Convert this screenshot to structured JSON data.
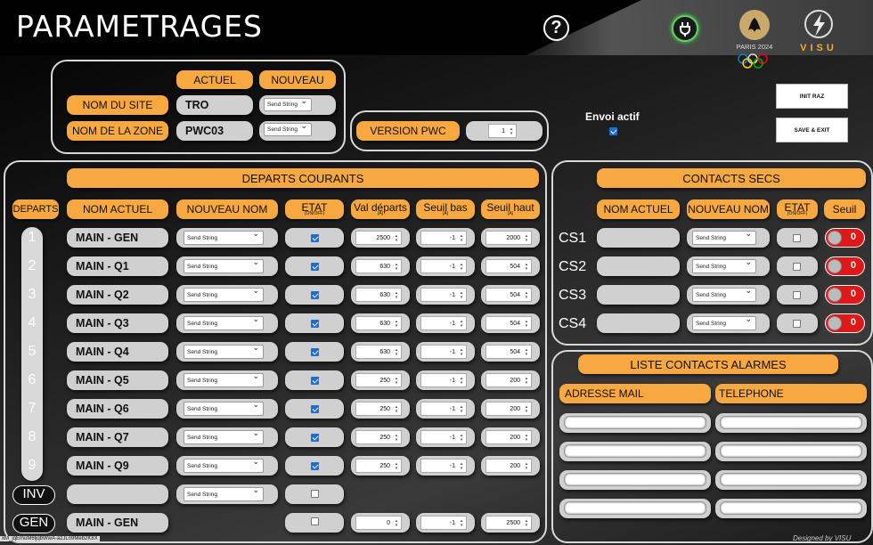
{
  "header": {
    "title": "PARAMETRAGES",
    "help": "?",
    "visu": "VISU",
    "paris": "PARIS 2024"
  },
  "site": {
    "col_actuel": "ACTUEL",
    "col_nouveau": "NOUVEAU",
    "rows": [
      {
        "label": "NOM DU SITE",
        "value": "TRO",
        "select": "Send String"
      },
      {
        "label": "NOM DE LA ZONE",
        "value": "PWC03",
        "select": "Send String"
      }
    ]
  },
  "version": {
    "label": "VERSION PWC",
    "value": "1"
  },
  "envoi": {
    "label": "Envoi actif",
    "checked": true
  },
  "buttons": {
    "init_raz": "INIT RAZ",
    "save_exit": "SAVE & EXIT"
  },
  "departs": {
    "title": "DEPARTS COURANTS",
    "headers": {
      "departs": "DEPARTS",
      "nom": "NOM ACTUEL",
      "nouveau": "NOUVEAU NOM",
      "etat": "ETAT",
      "etat_sub": "(ON/OFF)",
      "val": "Val départs",
      "val_sub": "(A)",
      "bas": "Seuil bas",
      "bas_sub": "(A)",
      "haut": "Seuil haut",
      "haut_sub": "(A)"
    },
    "rows": [
      {
        "id": "1",
        "nom": "MAIN - GEN",
        "sel": "Send String",
        "etat": true,
        "val": "2500",
        "bas": "-1",
        "haut": "2000"
      },
      {
        "id": "2",
        "nom": "MAIN - Q1",
        "sel": "Send String",
        "etat": true,
        "val": "630",
        "bas": "-1",
        "haut": "504"
      },
      {
        "id": "3",
        "nom": "MAIN - Q2",
        "sel": "Send String",
        "etat": true,
        "val": "630",
        "bas": "-1",
        "haut": "504"
      },
      {
        "id": "4",
        "nom": "MAIN - Q3",
        "sel": "Send String",
        "etat": true,
        "val": "630",
        "bas": "-1",
        "haut": "504"
      },
      {
        "id": "5",
        "nom": "MAIN - Q4",
        "sel": "Send String",
        "etat": true,
        "val": "630",
        "bas": "-1",
        "haut": "504"
      },
      {
        "id": "6",
        "nom": "MAIN - Q5",
        "sel": "Send String",
        "etat": true,
        "val": "250",
        "bas": "-1",
        "haut": "200"
      },
      {
        "id": "7",
        "nom": "MAIN - Q6",
        "sel": "Send String",
        "etat": true,
        "val": "250",
        "bas": "-1",
        "haut": "200"
      },
      {
        "id": "8",
        "nom": "MAIN - Q7",
        "sel": "Send String",
        "etat": true,
        "val": "250",
        "bas": "-1",
        "haut": "200"
      },
      {
        "id": "9",
        "nom": "MAIN - Q9",
        "sel": "Send String",
        "etat": true,
        "val": "250",
        "bas": "-1",
        "haut": "200"
      }
    ],
    "inv": {
      "id": "INV",
      "nom": "",
      "sel": "Send String",
      "etat": false
    },
    "gen": {
      "id": "GEN",
      "nom": "MAIN - GEN",
      "etat": false,
      "val": "0",
      "bas": "-1",
      "haut": "2500"
    }
  },
  "contacts": {
    "title": "CONTACTS SECS",
    "headers": {
      "nom": "NOM ACTUEL",
      "nouveau": "NOUVEAU NOM",
      "etat": "ETAT",
      "etat_sub": "(ON/OFF)",
      "seuil": "Seuil"
    },
    "rows": [
      {
        "id": "CS1",
        "sel": "Send String",
        "seuil": "0"
      },
      {
        "id": "CS2",
        "sel": "Send String",
        "seuil": "0"
      },
      {
        "id": "CS3",
        "sel": "Send String",
        "seuil": "0"
      },
      {
        "id": "CS4",
        "sel": "Send String",
        "seuil": "0"
      }
    ]
  },
  "alarmes": {
    "title": "LISTE CONTACTS ALARMES",
    "mail": "ADRESSE MAIL",
    "tel": "TELEPHONE"
  },
  "footer": {
    "left": "xM_jqEmuM6ljqbWwA-azJLn9Meb2K8X",
    "right": "Designed by VISU"
  },
  "colors": {
    "accent": "#f7a841",
    "toggle_red": "#e01818",
    "check_blue": "#1a6fd4"
  }
}
